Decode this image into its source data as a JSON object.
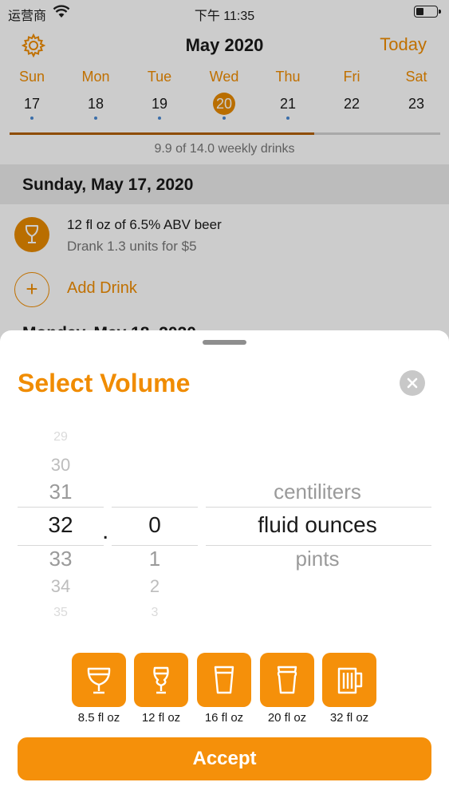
{
  "status": {
    "carrier": "运营商",
    "time": "下午 11:35"
  },
  "header": {
    "title": "May 2020",
    "today_label": "Today"
  },
  "week": {
    "days": [
      {
        "name": "Sun",
        "num": "17",
        "dot": true,
        "selected": false
      },
      {
        "name": "Mon",
        "num": "18",
        "dot": true,
        "selected": false
      },
      {
        "name": "Tue",
        "num": "19",
        "dot": true,
        "selected": false
      },
      {
        "name": "Wed",
        "num": "20",
        "dot": true,
        "selected": true
      },
      {
        "name": "Thu",
        "num": "21",
        "dot": true,
        "selected": false
      },
      {
        "name": "Fri",
        "num": "22",
        "dot": false,
        "selected": false
      },
      {
        "name": "Sat",
        "num": "23",
        "dot": false,
        "selected": false
      }
    ],
    "weekly_text": "9.9 of 14.0 weekly drinks",
    "drinks_consumed": 9.9,
    "drinks_limit": 14.0
  },
  "log": {
    "section_title": "Sunday, May 17, 2020",
    "drink_title": "12 fl oz of 6.5% ABV beer",
    "drink_detail": "Drank 1.3 units for $5",
    "add_label": "Add Drink",
    "next_section": "Monday, May 18, 2020"
  },
  "sheet": {
    "title": "Select Volume",
    "picker": {
      "whole": [
        "29",
        "30",
        "31",
        "32",
        "33",
        "34",
        "35"
      ],
      "whole_selected": "32",
      "decimal_separator": ".",
      "fraction": [
        "0",
        "1",
        "2",
        "3"
      ],
      "fraction_selected": "0",
      "units": [
        "centiliters",
        "fluid ounces",
        "pints"
      ],
      "unit_selected": "fluid ounces"
    },
    "presets": [
      {
        "label": "8.5 fl oz",
        "icon": "wine-glass-icon"
      },
      {
        "label": "12 fl oz",
        "icon": "tulip-glass-icon"
      },
      {
        "label": "16 fl oz",
        "icon": "pint-glass-icon"
      },
      {
        "label": "20 fl oz",
        "icon": "nonic-pint-icon"
      },
      {
        "label": "32 fl oz",
        "icon": "beer-mug-icon"
      }
    ],
    "accept_label": "Accept"
  },
  "colors": {
    "accent": "#f5900a",
    "accent_dark": "#b26000",
    "dot": "#4a8ad4"
  }
}
